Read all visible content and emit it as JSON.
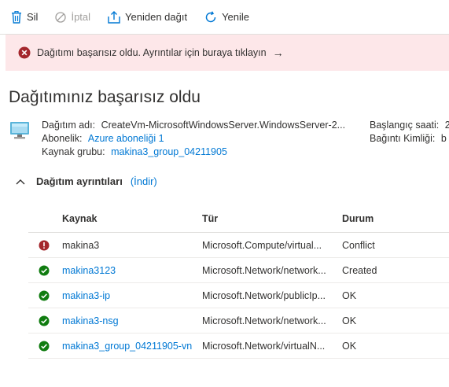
{
  "toolbar": {
    "delete_label": "Sil",
    "cancel_label": "İptal",
    "redeploy_label": "Yeniden dağıt",
    "refresh_label": "Yenile"
  },
  "banner": {
    "text": "Dağıtımı başarısız oldu. Ayrıntılar için buraya tıklayın",
    "arrow": "→"
  },
  "page_title": "Dağıtımınız başarısız oldu",
  "summary": {
    "deployment_name_label": "Dağıtım adı:",
    "deployment_name_value": "CreateVm-MicrosoftWindowsServer.WindowsServer-2...",
    "subscription_label": "Abonelik:",
    "subscription_value": "Azure aboneliği 1",
    "resource_group_label": "Kaynak grubu:",
    "resource_group_value": "makina3_group_04211905",
    "start_time_label": "Başlangıç saati:",
    "start_time_value": "2",
    "correlation_label": "Bağıntı Kimliği:",
    "correlation_value": "b"
  },
  "details": {
    "title": "Dağıtım ayrıntıları",
    "download_label": "(İndir)"
  },
  "table": {
    "headers": {
      "resource": "Kaynak",
      "type": "Tür",
      "status": "Durum"
    },
    "rows": [
      {
        "status_icon": "error-icon",
        "name": "makina3",
        "type": "Microsoft.Compute/virtual...",
        "status": "Conflict",
        "link": false
      },
      {
        "status_icon": "success-icon",
        "name": "makina3123",
        "type": "Microsoft.Network/network...",
        "status": "Created",
        "link": true
      },
      {
        "status_icon": "success-icon",
        "name": "makina3-ip",
        "type": "Microsoft.Network/publicIp...",
        "status": "OK",
        "link": true
      },
      {
        "status_icon": "success-icon",
        "name": "makina3-nsg",
        "type": "Microsoft.Network/network...",
        "status": "OK",
        "link": true
      },
      {
        "status_icon": "success-icon",
        "name": "makina3_group_04211905-vn",
        "type": "Microsoft.Network/virtualN...",
        "status": "OK",
        "link": true
      }
    ]
  },
  "colors": {
    "accent": "#0078d4",
    "error": "#a4262c",
    "success": "#107c10",
    "banner_bg": "#fde7e9"
  }
}
